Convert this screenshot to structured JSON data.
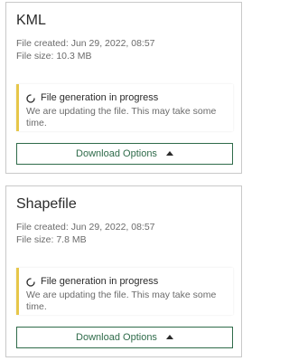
{
  "cards": [
    {
      "title": "KML",
      "created": "File created: Jun 29, 2022, 08:57",
      "size": "File size: 10.3 MB",
      "notice_title": "File generation in progress",
      "notice_body": "We are updating the file. This may take some time.",
      "download_label": "Download Options"
    },
    {
      "title": "Shapefile",
      "created": "File created: Jun 29, 2022, 08:57",
      "size": "File size: 7.8 MB",
      "notice_title": "File generation in progress",
      "notice_body": "We are updating the file. This may take some time.",
      "download_label": "Download Options"
    }
  ],
  "icons": {
    "spinner": "loading-spinner-icon",
    "caret": "caret-up-icon"
  },
  "colors": {
    "accent": "#2f6b4a",
    "notice_border": "#e7c74a",
    "card_border": "#c9c9c9"
  }
}
